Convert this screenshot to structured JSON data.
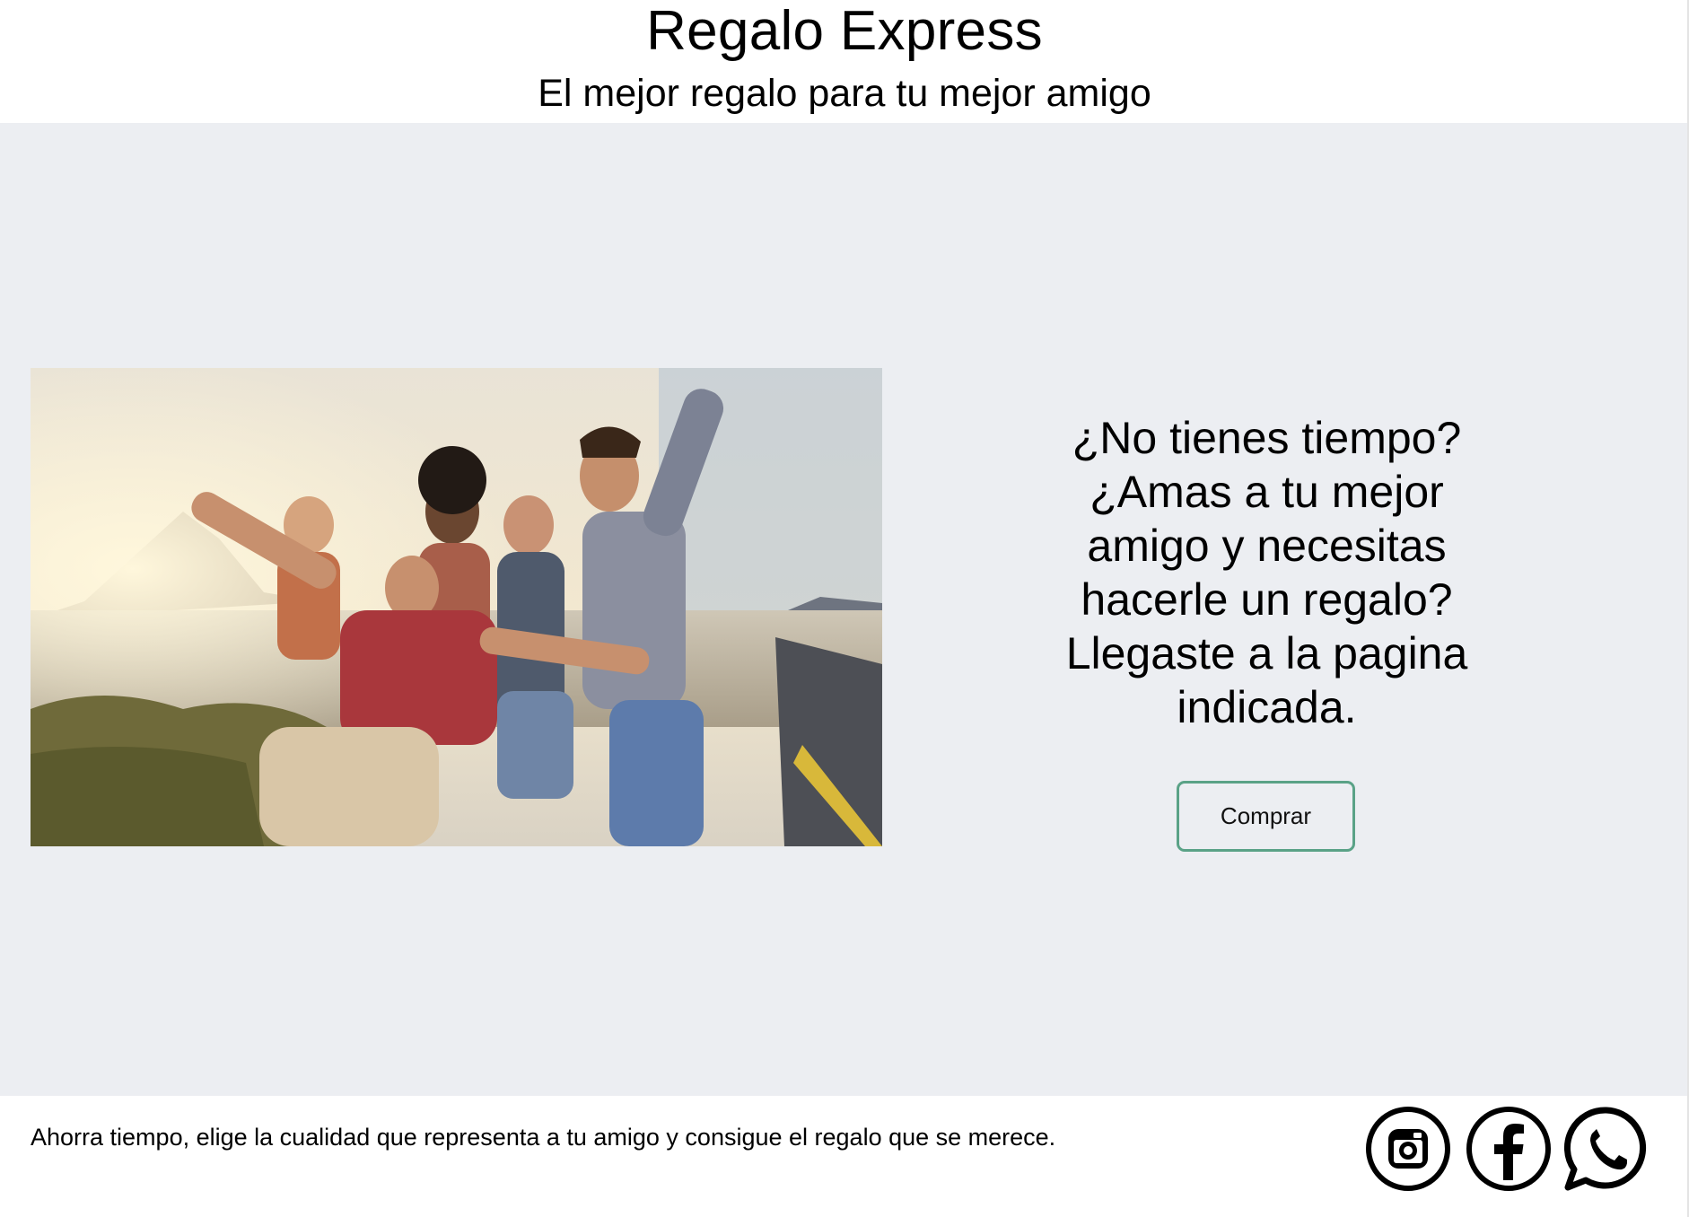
{
  "header": {
    "title": "Regalo Express",
    "subtitle": "El mejor regalo para tu mejor amigo"
  },
  "hero": {
    "image_icon": "group-of-friends-photo",
    "lines": [
      "¿No tienes tiempo?",
      "¿Amas a tu mejor",
      "amigo y necesitas",
      "hacerle un regalo?",
      "Llegaste a la pagina",
      "indicada."
    ],
    "button_label": "Comprar"
  },
  "footer": {
    "text": "Ahorra tiempo, elige la cualidad que representa a tu amigo y consigue el regalo que se merece.",
    "social": [
      "instagram-icon",
      "facebook-icon",
      "whatsapp-icon"
    ]
  },
  "colors": {
    "main_background": "#eceef2",
    "button_border": "#5aa287",
    "header_background": "#ffffff",
    "footer_background": "#ffffff"
  }
}
